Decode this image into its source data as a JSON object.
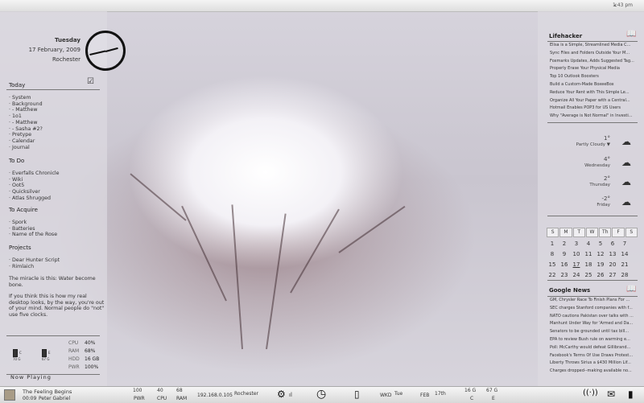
{
  "topbar": {
    "time": "1:43 pm",
    "arrow": "‹"
  },
  "left": {
    "day": "Tuesday",
    "date": "17 February, 2009",
    "location": "Rochester",
    "today_title": "Today",
    "today_items": [
      "· System",
      "· Background",
      "· - Matthew",
      "· 1o1",
      "· - Matthew",
      "· - Sasha #2?",
      "· Pretype",
      "· Calendar",
      "· Journal"
    ],
    "todo_title": "To Do",
    "todo_items": [
      "· Everfalls Chronicle",
      "· Wiki",
      "· Oot5",
      "· Quicksilver",
      "· Atlas Shrugged"
    ],
    "acquire_title": "To Acquire",
    "acquire_items": [
      "· Spork",
      "· Batteries",
      "· Name of the Rose"
    ],
    "projects_title": "Projects",
    "projects_items": [
      "· Dear Hunter Script",
      "· Rimlaich"
    ],
    "note1": "The miracle is this: Water become bone.",
    "note2": "If you think this is how my real desktop looks, by the way, you're out of your mind. Normal people do \"not\" use five clocks.",
    "drive1": "C\n70 G",
    "drive2": "E\n67 G",
    "stats": [
      {
        "label": "CPU",
        "value": "40%"
      },
      {
        "label": "RAM",
        "value": "68%"
      },
      {
        "label": "HDD",
        "value": "16 GB"
      },
      {
        "label": "PWR",
        "value": "100%"
      }
    ],
    "now_playing": "Now Playing"
  },
  "right": {
    "lifehacker_title": "Lifehacker",
    "lifehacker_items": [
      "Elisa is a Simple, Streamlined Media C...",
      "Sync Files and Folders Outside Your M...",
      "Foxmarks Updates, Adds Suggested Tag...",
      "Properly Erase Your Physical Media",
      "Top 10 Outlook Boosters",
      "Build a Custom-Made BoxeeBox",
      "Reduce Your Rent with This Simple Le...",
      "Organize All Your Paper with a Central...",
      "Hotmail Enables POP3 for US Users",
      "Why \"Average is Not Normal\" in Investi..."
    ],
    "weather": [
      {
        "temp": "1°",
        "cond": "Partly Cloudy ▼",
        "icon": "☁"
      },
      {
        "temp": "4°",
        "cond": "Wednesday",
        "icon": "☁"
      },
      {
        "temp": "2°",
        "cond": "Thursday",
        "icon": "☁"
      },
      {
        "temp": "-2°",
        "cond": "Friday",
        "icon": "☁"
      }
    ],
    "calendar_head": [
      "S",
      "M",
      "T",
      "W",
      "Th",
      "F",
      "S"
    ],
    "calendar_rows": [
      [
        "1",
        "2",
        "3",
        "4",
        "5",
        "6",
        "7"
      ],
      [
        "8",
        "9",
        "10",
        "11",
        "12",
        "13",
        "14"
      ],
      [
        "15",
        "16",
        "17",
        "18",
        "19",
        "20",
        "21"
      ],
      [
        "22",
        "23",
        "24",
        "25",
        "26",
        "27",
        "28"
      ]
    ],
    "news_title": "Google News",
    "news_items": [
      "GM, Chrysler Race To Finish Plans For ...",
      "SEC charges Stanford companies with f...",
      "NATO cautions Pakistan over talks with ...",
      "Manhunt Under Way for 'Armed and Da...",
      "Senators to be grounded until tax bill...",
      "EPA to review Bush rule on warming e...",
      "Poll: McCarthy would defeat Gillibrand...",
      "Facebook's Terms Of Use Draws Protest...",
      "Liberty Throws Sirius a $430 Million Lif...",
      "Charges dropped--making available no..."
    ]
  },
  "taskbar": {
    "track": "The Feeling Begins",
    "track_time": "00:09",
    "artist": "Peter Gabriel",
    "pwr": "100",
    "pwr_label": "PWR",
    "cpu": "40",
    "cpu_label": "CPU",
    "ram": "68",
    "ram_label": "RAM",
    "ip": "192.168.0.105",
    "city": "Rochester",
    "wkd_label": "WKD",
    "wkd": "Tue",
    "feb_label": "FEB",
    "feb": "17th",
    "disk1": "16 G",
    "disk1_label": "C",
    "disk2": "67 G",
    "disk2_label": "E"
  }
}
